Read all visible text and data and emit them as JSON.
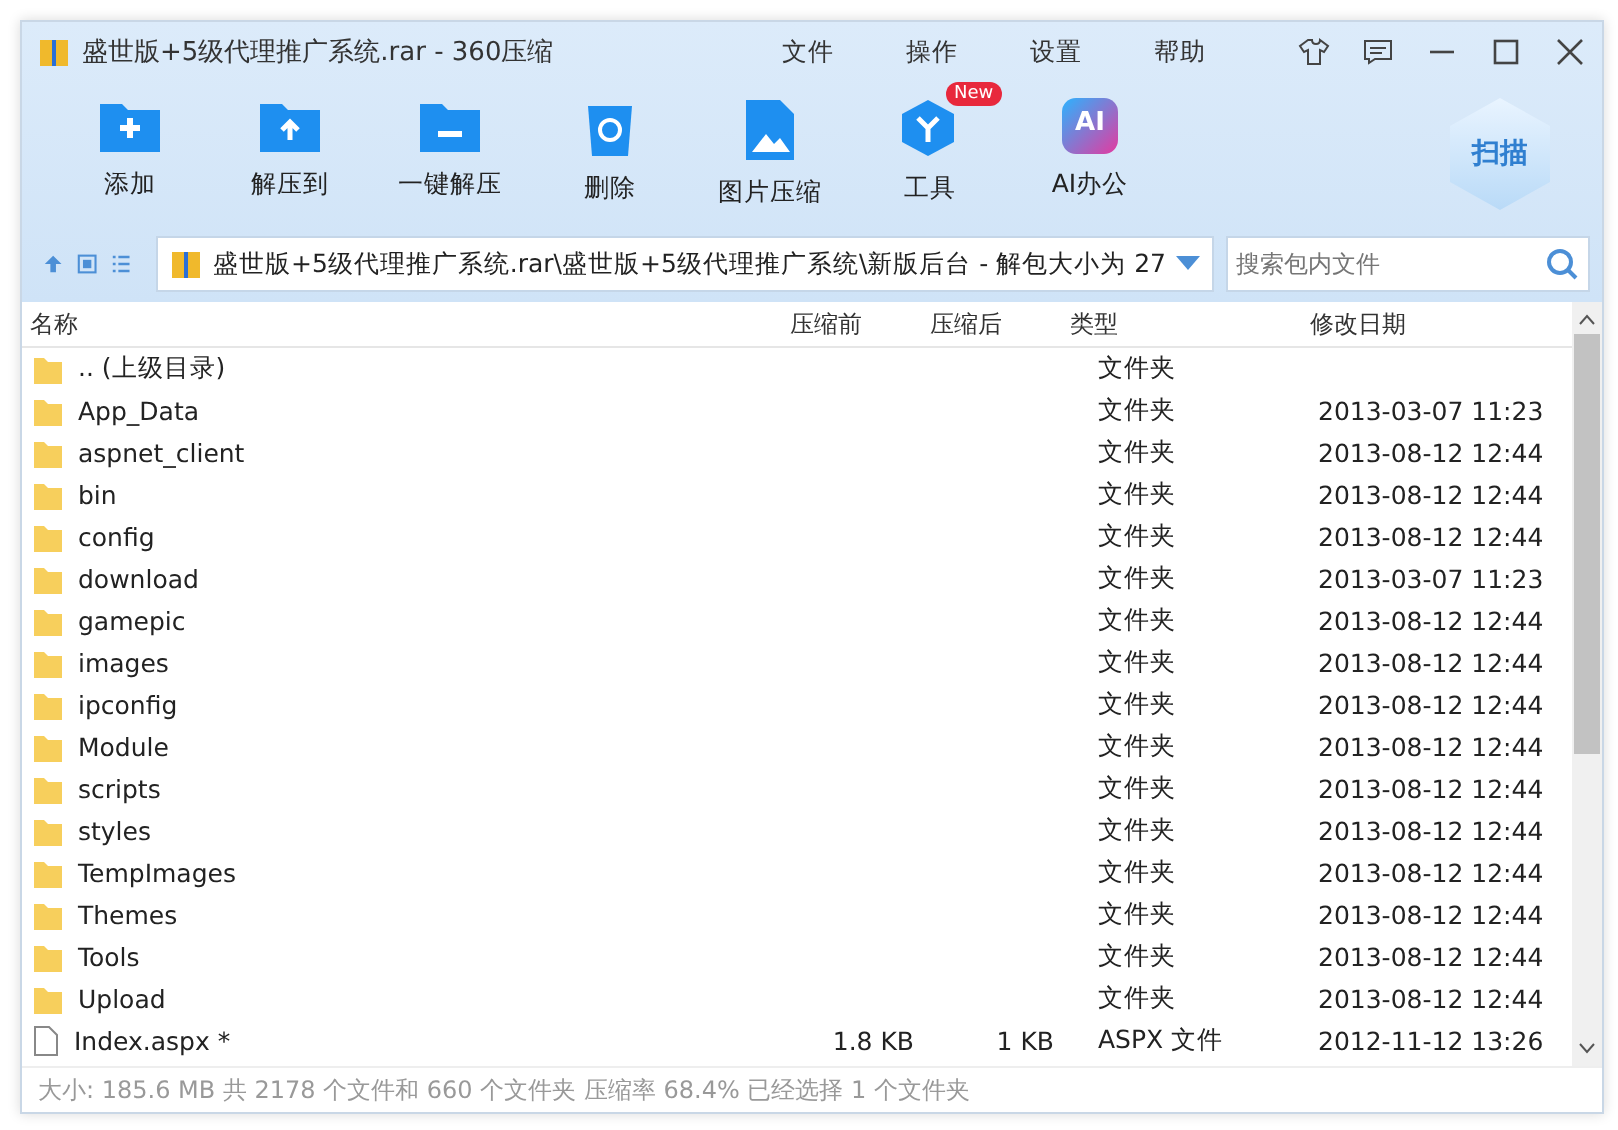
{
  "window": {
    "title": "盛世版+5级代理推广系统.rar - 360压缩"
  },
  "menu": [
    "文件",
    "操作",
    "设置",
    "帮助"
  ],
  "toolbar": [
    {
      "label": "添加",
      "kind": "add"
    },
    {
      "label": "解压到",
      "kind": "extract"
    },
    {
      "label": "一键解压",
      "kind": "oneclick"
    },
    {
      "label": "删除",
      "kind": "delete"
    },
    {
      "label": "图片压缩",
      "kind": "image"
    },
    {
      "label": "工具",
      "kind": "tools",
      "badge": "New"
    },
    {
      "label": "AI办公",
      "kind": "ai",
      "icon_text": "AI"
    }
  ],
  "scan_button": "扫描",
  "address": {
    "path": "盛世版+5级代理推广系统.rar\\盛世版+5级代理推广系统\\新版后台 - 解包大小为 27"
  },
  "search": {
    "placeholder": "搜索包内文件"
  },
  "table": {
    "columns": [
      "名称",
      "压缩前",
      "压缩后",
      "类型",
      "修改日期"
    ],
    "rows": [
      {
        "kind": "folder",
        "name": ".. (上级目录)",
        "before": "",
        "after": "",
        "type": "文件夹",
        "date": ""
      },
      {
        "kind": "folder",
        "name": "App_Data",
        "type": "文件夹",
        "date": "2013-03-07 11:23"
      },
      {
        "kind": "folder",
        "name": "aspnet_client",
        "type": "文件夹",
        "date": "2013-08-12 12:44"
      },
      {
        "kind": "folder",
        "name": "bin",
        "type": "文件夹",
        "date": "2013-08-12 12:44"
      },
      {
        "kind": "folder",
        "name": "config",
        "type": "文件夹",
        "date": "2013-08-12 12:44"
      },
      {
        "kind": "folder",
        "name": "download",
        "type": "文件夹",
        "date": "2013-03-07 11:23"
      },
      {
        "kind": "folder",
        "name": "gamepic",
        "type": "文件夹",
        "date": "2013-08-12 12:44"
      },
      {
        "kind": "folder",
        "name": "images",
        "type": "文件夹",
        "date": "2013-08-12 12:44"
      },
      {
        "kind": "folder",
        "name": "ipconfig",
        "type": "文件夹",
        "date": "2013-08-12 12:44"
      },
      {
        "kind": "folder",
        "name": "Module",
        "type": "文件夹",
        "date": "2013-08-12 12:44"
      },
      {
        "kind": "folder",
        "name": "scripts",
        "type": "文件夹",
        "date": "2013-08-12 12:44"
      },
      {
        "kind": "folder",
        "name": "styles",
        "type": "文件夹",
        "date": "2013-08-12 12:44"
      },
      {
        "kind": "folder",
        "name": "TempImages",
        "type": "文件夹",
        "date": "2013-08-12 12:44"
      },
      {
        "kind": "folder",
        "name": "Themes",
        "type": "文件夹",
        "date": "2013-08-12 12:44"
      },
      {
        "kind": "folder",
        "name": "Tools",
        "type": "文件夹",
        "date": "2013-08-12 12:44"
      },
      {
        "kind": "folder",
        "name": "Upload",
        "type": "文件夹",
        "date": "2013-08-12 12:44"
      },
      {
        "kind": "file",
        "name": "Index.aspx *",
        "before": "1.8 KB",
        "after": "1 KB",
        "type": "ASPX 文件",
        "date": "2012-11-12 13:26"
      }
    ]
  },
  "status_bar": "大小: 185.6 MB 共 2178 个文件和 660 个文件夹 压缩率 68.4% 已经选择 1 个文件夹"
}
